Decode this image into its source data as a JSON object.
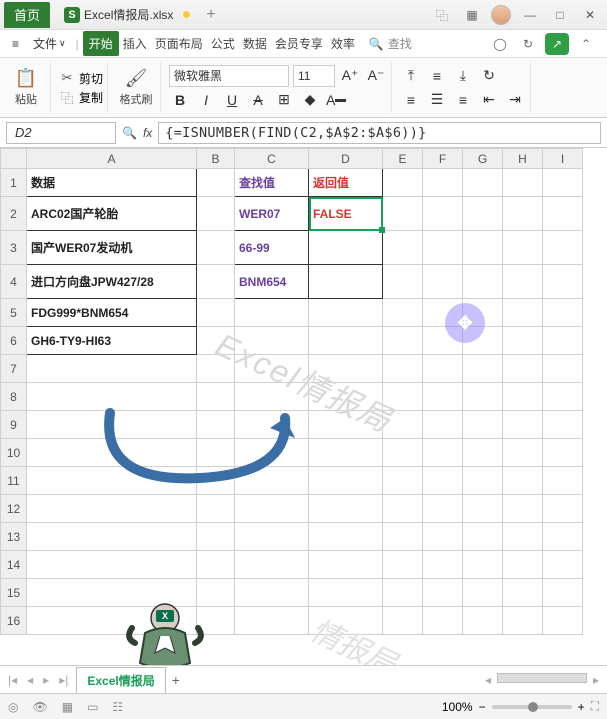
{
  "titlebar": {
    "home": "首页",
    "file_logo": "S",
    "file_name": "Excel情报局.xlsx",
    "icons": {
      "layout": "⿻",
      "grid": "▦",
      "min": "—",
      "max": "□",
      "close": "✕"
    }
  },
  "menubar": {
    "menu_icon": "≡",
    "file_btn": "文件",
    "items": [
      "开始",
      "插入",
      "页面布局",
      "公式",
      "数据",
      "会员专享",
      "效率"
    ],
    "active_index": 0,
    "search_label": "查找",
    "right_icons": {
      "cloud": "◯",
      "history": "↻",
      "undo": "↶"
    }
  },
  "ribbon": {
    "paste": "粘贴",
    "cut": "剪切",
    "copy": "复制",
    "format_painter": "格式刷",
    "font_name": "微软雅黑",
    "font_size": "11"
  },
  "refbar": {
    "cell_ref": "D2",
    "fx": "fx",
    "formula": "{=ISNUMBER(FIND(C2,$A$2:$A$6))}"
  },
  "grid": {
    "columns": [
      "A",
      "B",
      "C",
      "D",
      "E",
      "F",
      "G",
      "H",
      "I"
    ],
    "col_classes": [
      "A",
      "B",
      "C",
      "D",
      "O",
      "O",
      "O",
      "O",
      "O"
    ],
    "rows": [
      {
        "n": "1",
        "h": "s",
        "A": "数据",
        "C": "查找值",
        "D": "返回值"
      },
      {
        "n": "2",
        "A": "ARC02国产轮胎",
        "C": "WER07",
        "D": "FALSE",
        "active_D": true
      },
      {
        "n": "3",
        "A": "国产WER07发动机",
        "C": "66-99"
      },
      {
        "n": "4",
        "A": "进口方向盘JPW427/28",
        "C": "BNM654"
      },
      {
        "n": "5",
        "h": "s",
        "A": "FDG999*BNM654"
      },
      {
        "n": "6",
        "h": "s",
        "A": "GH6-TY9-HI63"
      },
      {
        "n": "7",
        "h": "s"
      },
      {
        "n": "8",
        "h": "s"
      },
      {
        "n": "9",
        "h": "s"
      },
      {
        "n": "10",
        "h": "s"
      },
      {
        "n": "11",
        "h": "s"
      },
      {
        "n": "12",
        "h": "s"
      },
      {
        "n": "13",
        "h": "s"
      },
      {
        "n": "14",
        "h": "s"
      },
      {
        "n": "15",
        "h": "s"
      },
      {
        "n": "16",
        "h": "s"
      }
    ]
  },
  "watermarks": {
    "a": "Excel情报局",
    "b": "情报局"
  },
  "sheettabs": {
    "tab_name": "Excel情报局",
    "add": "+"
  },
  "statusbar": {
    "zoom_pct": "100%",
    "zoom_minus": "−",
    "zoom_plus": "+"
  }
}
